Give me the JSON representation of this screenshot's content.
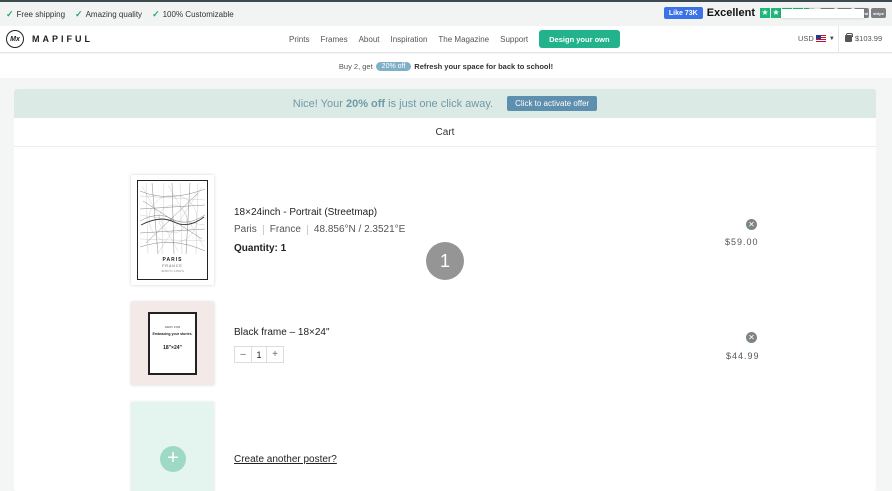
{
  "promo_bar": {
    "usps": [
      "Free shipping",
      "Amazing quality",
      "100% Customizable"
    ],
    "fb_like": "Like 73K",
    "rating_label": "Excellent",
    "rating_stars": 4.5,
    "payment_methods": [
      "VISA",
      "MC",
      "PayPal",
      "stripe"
    ]
  },
  "header": {
    "brand": "MAPIFUL",
    "nav": [
      "Prints",
      "Frames",
      "About",
      "Inspiration",
      "The Magazine",
      "Support"
    ],
    "cta": "Design your own",
    "currency": "USD",
    "cart_total": "$103.99"
  },
  "offer_strip": {
    "lead": "Buy 2, get",
    "pill": "20% off",
    "text": "Refresh your space for back to school!"
  },
  "offer_banner": {
    "msg_start": "Nice! Your ",
    "msg_bold": "20% off",
    "msg_end": " is just one click away.",
    "button": "Click to activate offer"
  },
  "cart": {
    "title": "Cart",
    "overlay_badge": "1",
    "items": [
      {
        "title": "18×24inch - Portrait (Streetmap)",
        "city": "Paris",
        "country": "France",
        "coords": "48.856°N / 2.3521°E",
        "quantity_label": "Quantity: 1",
        "price": "$59.00",
        "thumb_city": "PARIS",
        "thumb_country": "FRANCE",
        "thumb_coords": "48.856°N / 2.3521°E"
      },
      {
        "title": "Black frame – 18×24\"",
        "quantity": "1",
        "minus": "–",
        "plus": "+",
        "price": "$44.99",
        "thumb_text1": "AWAY FOR",
        "thumb_text2": "Embracing your stories.",
        "thumb_text3": "18\"×24\""
      }
    ],
    "create_link": "Create another poster?"
  },
  "colors": {
    "accent_green": "#22b38d",
    "offer_banner_bg": "#dbeae5",
    "activate_btn": "#5f8fae"
  }
}
